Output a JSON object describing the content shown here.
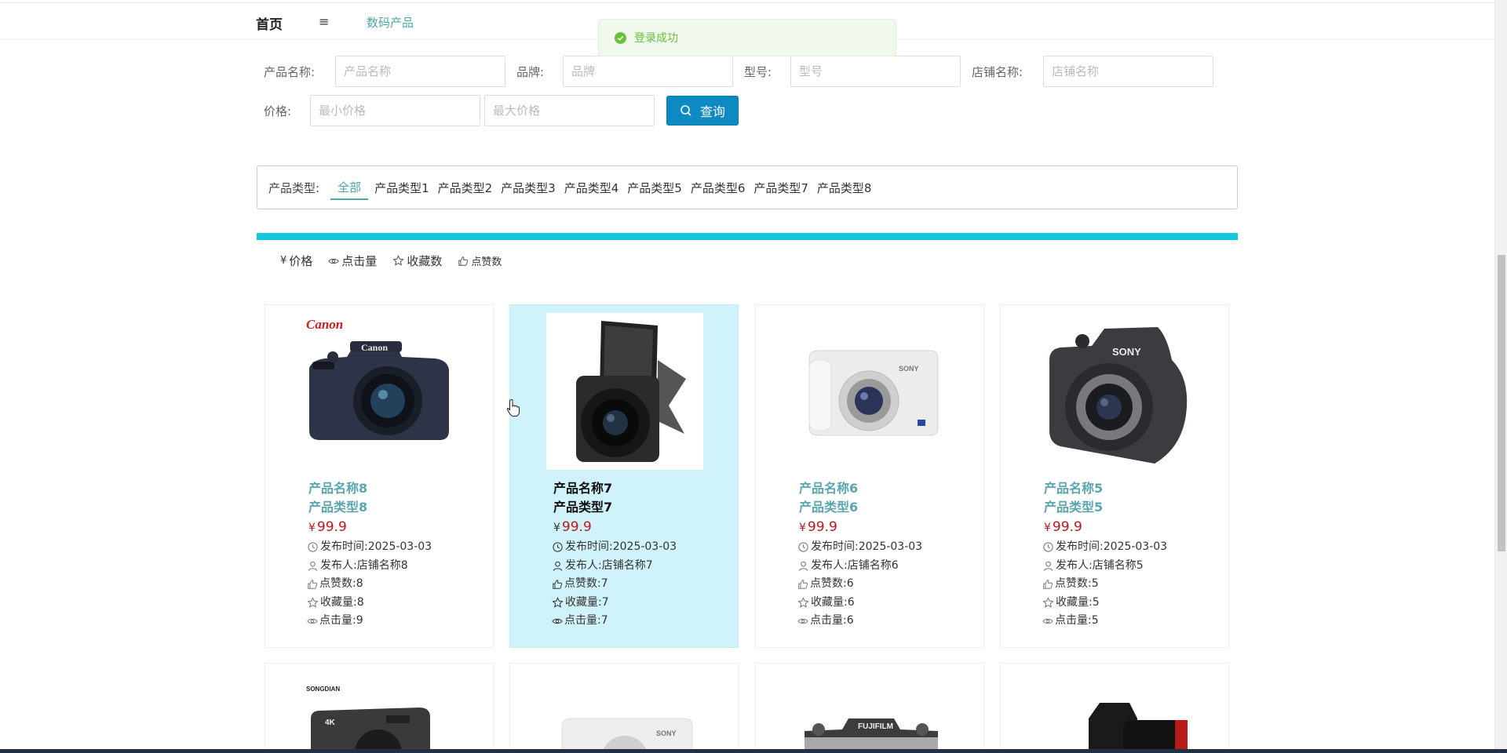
{
  "header": {
    "home": "首页",
    "menu_icon": "≡",
    "current": "数码产品"
  },
  "toast": {
    "text": "登录成功",
    "color": "#67c23a"
  },
  "search": {
    "name_label": "产品名称:",
    "name_placeholder": "产品名称",
    "brand_label": "品牌:",
    "brand_placeholder": "品牌",
    "model_label": "型号:",
    "model_placeholder": "型号",
    "shop_label": "店铺名称:",
    "shop_placeholder": "店铺名称",
    "price_label": "价格:",
    "min_placeholder": "最小价格",
    "max_placeholder": "最大价格",
    "button": "查询"
  },
  "categories": {
    "label": "产品类型:",
    "items": [
      "全部",
      "产品类型1",
      "产品类型2",
      "产品类型3",
      "产品类型4",
      "产品类型5",
      "产品类型6",
      "产品类型7",
      "产品类型8"
    ],
    "active": "全部"
  },
  "sort": {
    "price": "价格",
    "clicks": "点击量",
    "favorites": "收藏数",
    "likes": "点赞数"
  },
  "meta_labels": {
    "date": "发布时间:",
    "publisher": "发布人:",
    "likes": "点赞数:",
    "favorites": "收藏量:",
    "clicks": "点击量:"
  },
  "products": [
    {
      "name": "产品名称8",
      "type": "产品类型8",
      "yen": "¥",
      "price": "99.9",
      "date": "2025-03-03",
      "publisher": "店铺名称8",
      "likes": "8",
      "favorites": "8",
      "clicks": "9",
      "brand_text": "Canon",
      "body_text": "Canon"
    },
    {
      "name": "产品名称7",
      "type": "产品类型7",
      "yen": "¥",
      "price": "99.9",
      "date": "2025-03-03",
      "publisher": "店铺名称7",
      "likes": "7",
      "favorites": "7",
      "clicks": "7"
    },
    {
      "name": "产品名称6",
      "type": "产品类型6",
      "yen": "¥",
      "price": "99.9",
      "date": "2025-03-03",
      "publisher": "店铺名称6",
      "likes": "6",
      "favorites": "6",
      "clicks": "6",
      "body_text": "SONY"
    },
    {
      "name": "产品名称5",
      "type": "产品类型5",
      "yen": "¥",
      "price": "99.9",
      "date": "2025-03-03",
      "publisher": "店铺名称5",
      "likes": "5",
      "favorites": "5",
      "clicks": "5",
      "body_text": "SONY"
    }
  ],
  "row2": [
    {
      "brand_text": "SONGDIAN",
      "badge": "4K"
    },
    {
      "body_text": "SONY"
    },
    {
      "body_text": "FUJIFILM"
    },
    {}
  ],
  "colors": {
    "accent": "#4aa9a8",
    "primary_button": "#0e8ac2",
    "price": "#c0161b",
    "banner": "#14c6de",
    "hover_card": "#d0f2fa"
  }
}
